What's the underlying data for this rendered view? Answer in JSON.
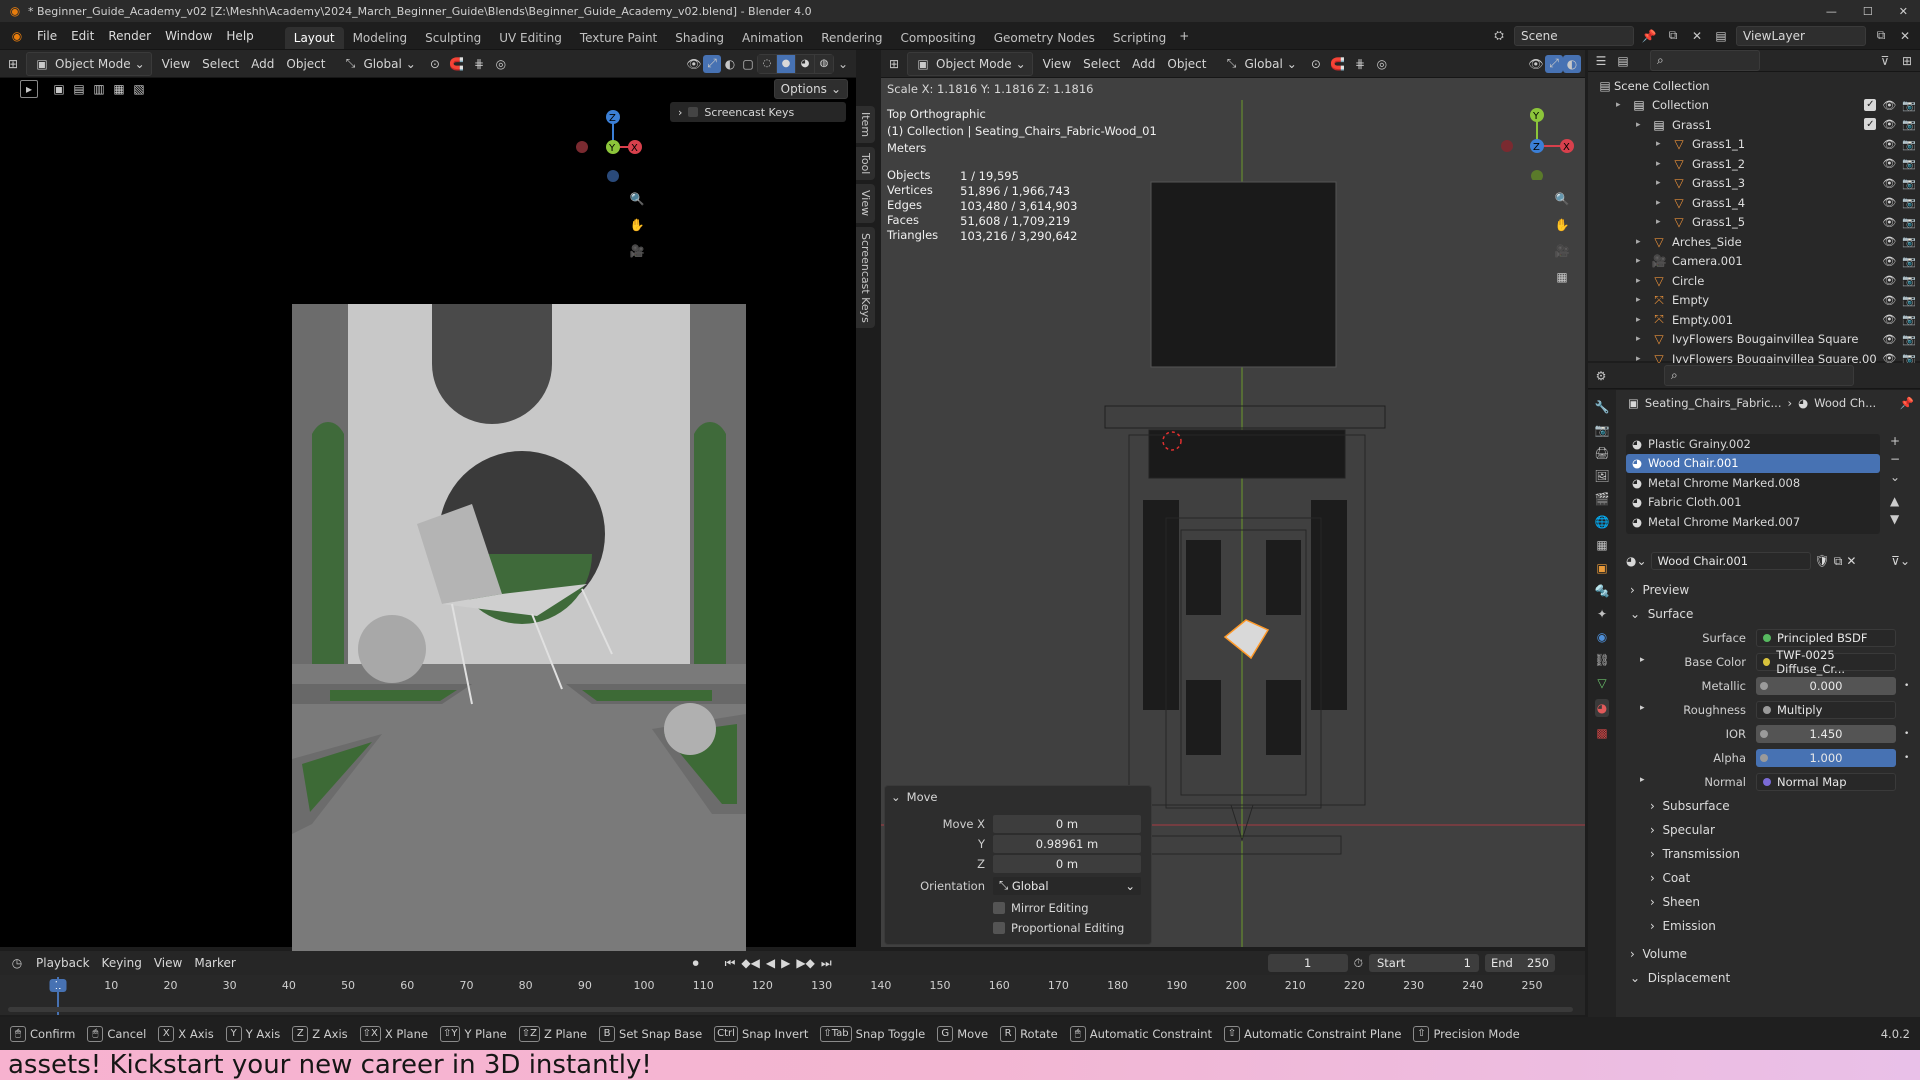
{
  "window": {
    "title": "* Beginner_Guide_Academy_v02 [Z:\\Meshh\\Academy\\2024_March_Beginner_Guide\\Blends\\Beginner_Guide_Academy_v02.blend] - Blender 4.0"
  },
  "menu": [
    "File",
    "Edit",
    "Render",
    "Window",
    "Help"
  ],
  "workspaces": [
    "Layout",
    "Modeling",
    "Sculpting",
    "UV Editing",
    "Texture Paint",
    "Shading",
    "Animation",
    "Rendering",
    "Compositing",
    "Geometry Nodes",
    "Scripting"
  ],
  "active_workspace": "Layout",
  "scene": {
    "name": "Scene",
    "view_layer": "ViewLayer"
  },
  "left_viewport": {
    "mode": "Object Mode",
    "menus": [
      "View",
      "Select",
      "Add",
      "Object"
    ],
    "orientation": "Global",
    "options_label": "Options",
    "screencast_keys": "Screencast Keys",
    "side_tabs": [
      "Item",
      "Tool",
      "View",
      "Screencast Keys"
    ]
  },
  "right_viewport": {
    "mode": "Object Mode",
    "menus": [
      "View",
      "Select",
      "Add",
      "Object"
    ],
    "orientation": "Global",
    "scale_readout": "Scale X: 1.1816   Y: 1.1816   Z: 1.1816",
    "view_name": "Top Orthographic",
    "collection_line": "(1) Collection | Seating_Chairs_Fabric-Wood_01",
    "units": "Meters",
    "stats": [
      {
        "label": "Objects",
        "value": "1 / 19,595"
      },
      {
        "label": "Vertices",
        "value": "51,896 / 1,966,743"
      },
      {
        "label": "Edges",
        "value": "103,480 / 3,614,903"
      },
      {
        "label": "Faces",
        "value": "51,608 / 1,709,219"
      },
      {
        "label": "Triangles",
        "value": "103,216 / 3,290,642"
      }
    ]
  },
  "move_panel": {
    "title": "Move",
    "move_x_label": "Move X",
    "move_x": "0 m",
    "y_label": "Y",
    "y": "0.98961 m",
    "z_label": "Z",
    "z": "0 m",
    "orientation_label": "Orientation",
    "orientation": "Global",
    "mirror_editing": "Mirror Editing",
    "proportional_editing": "Proportional Editing"
  },
  "outliner": {
    "root": "Scene Collection",
    "items": [
      {
        "name": "Collection",
        "depth": 1,
        "icon": "collection-icon"
      },
      {
        "name": "Grass1",
        "depth": 2,
        "icon": "collection-icon"
      },
      {
        "name": "Grass1_1",
        "depth": 3,
        "icon": "mesh-icon"
      },
      {
        "name": "Grass1_2",
        "depth": 3,
        "icon": "mesh-icon"
      },
      {
        "name": "Grass1_3",
        "depth": 3,
        "icon": "mesh-icon"
      },
      {
        "name": "Grass1_4",
        "depth": 3,
        "icon": "mesh-icon"
      },
      {
        "name": "Grass1_5",
        "depth": 3,
        "icon": "mesh-icon"
      },
      {
        "name": "Arches_Side",
        "depth": 2,
        "icon": "mesh-icon"
      },
      {
        "name": "Camera.001",
        "depth": 2,
        "icon": "camera-icon"
      },
      {
        "name": "Circle",
        "depth": 2,
        "icon": "mesh-icon"
      },
      {
        "name": "Empty",
        "depth": 2,
        "icon": "empty-icon"
      },
      {
        "name": "Empty.001",
        "depth": 2,
        "icon": "empty-icon"
      },
      {
        "name": "IvyFlowers Bougainvillea Square",
        "depth": 2,
        "icon": "mesh-icon"
      },
      {
        "name": "IvyFlowers Bougainvillea Square.00",
        "depth": 2,
        "icon": "mesh-icon"
      }
    ]
  },
  "properties": {
    "breadcrumb_object": "Seating_Chairs_Fabric...",
    "breadcrumb_material": "Wood Ch...",
    "material_slots": [
      "Plastic Grainy.002",
      "Wood Chair.001",
      "Metal Chrome Marked.008",
      "Fabric Cloth.001",
      "Metal Chrome Marked.007"
    ],
    "active_slot": "Wood Chair.001",
    "material_name": "Wood Chair.001",
    "sections": {
      "preview": "Preview",
      "surface": "Surface",
      "subsurface": "Subsurface",
      "specular": "Specular",
      "transmission": "Transmission",
      "coat": "Coat",
      "sheen": "Sheen",
      "emission": "Emission",
      "volume": "Volume",
      "displacement": "Displacement"
    },
    "surface_rows": [
      {
        "label": "Surface",
        "value": "Principled BSDF",
        "dot": "#57b960",
        "type": "link"
      },
      {
        "label": "Base Color",
        "value": "TWF-0025 Diffuse_Cr...",
        "dot": "#d8c23c",
        "type": "link"
      },
      {
        "label": "Metallic",
        "value": "0.000",
        "dot": "#9a9a9a",
        "type": "num"
      },
      {
        "label": "Roughness",
        "value": "Multiply",
        "dot": "#9a9a9a",
        "type": "link"
      },
      {
        "label": "IOR",
        "value": "1.450",
        "dot": "#9a9a9a",
        "type": "num"
      },
      {
        "label": "Alpha",
        "value": "1.000",
        "dot": "#9a9a9a",
        "type": "active"
      },
      {
        "label": "Normal",
        "value": "Normal Map",
        "dot": "#7b6bd6",
        "type": "link"
      }
    ]
  },
  "timeline": {
    "menus": [
      "Playback",
      "Keying",
      "View",
      "Marker"
    ],
    "current_frame": "1",
    "start_label": "Start",
    "start": "1",
    "end_label": "End",
    "end": "250",
    "ticks": [
      "1",
      "10",
      "20",
      "30",
      "40",
      "50",
      "60",
      "70",
      "80",
      "90",
      "100",
      "110",
      "120",
      "130",
      "140",
      "150",
      "160",
      "170",
      "180",
      "190",
      "200",
      "210",
      "220",
      "230",
      "240",
      "250"
    ]
  },
  "status_bar": {
    "items": [
      {
        "key": "",
        "label": "Confirm"
      },
      {
        "key": "",
        "label": "Cancel"
      },
      {
        "key": "X",
        "label": "X Axis"
      },
      {
        "key": "Y",
        "label": "Y Axis"
      },
      {
        "key": "Z",
        "label": "Z Axis"
      },
      {
        "key": "⇧X",
        "label": "X Plane"
      },
      {
        "key": "⇧Y",
        "label": "Y Plane"
      },
      {
        "key": "⇧Z",
        "label": "Z Plane"
      },
      {
        "key": "B",
        "label": "Set Snap Base"
      },
      {
        "key": "Ctrl",
        "label": "Snap Invert"
      },
      {
        "key": "⇧Tab",
        "label": "Snap Toggle"
      },
      {
        "key": "G",
        "label": "Move"
      },
      {
        "key": "R",
        "label": "Rotate"
      },
      {
        "key": "",
        "label": "Automatic Constraint"
      },
      {
        "key": "⇧",
        "label": "Automatic Constraint Plane"
      },
      {
        "key": "⇧",
        "label": "Precision Mode"
      }
    ],
    "version": "4.0.2"
  },
  "banner": "assets! Kickstart your new career in 3D instantly!",
  "colors": {
    "accent": "#4772b3",
    "x_axis": "#d8404c",
    "y_axis": "#8cc53a",
    "z_axis": "#3b7fd6"
  }
}
